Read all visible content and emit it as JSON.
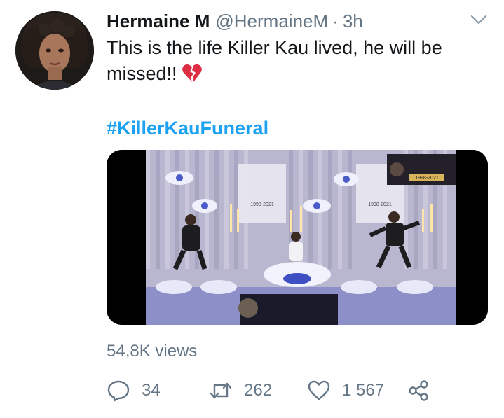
{
  "tweet": {
    "author_name": "Hermaine M",
    "author_handle": "@HermaineM",
    "separator": "·",
    "time": "3h",
    "text": "This is the life Killer Kau lived, he will be missed!!",
    "hashtag": "#KillerKauFuneral",
    "views": "54,8K views"
  },
  "media": {
    "banner_dates": "1998-2021",
    "corner_dates": "1998-2021"
  },
  "actions": {
    "reply_count": "34",
    "retweet_count": "262",
    "like_count": "1 567"
  },
  "icons": {
    "avatar": "avatar-photo",
    "emoji": "broken-heart-icon",
    "reply": "reply-icon",
    "retweet": "retweet-icon",
    "like": "like-icon",
    "share": "share-icon",
    "menu": "chevron-down-icon"
  },
  "colors": {
    "link": "#1da1f2",
    "secondary_text": "#657786",
    "primary_text": "#14171a"
  }
}
